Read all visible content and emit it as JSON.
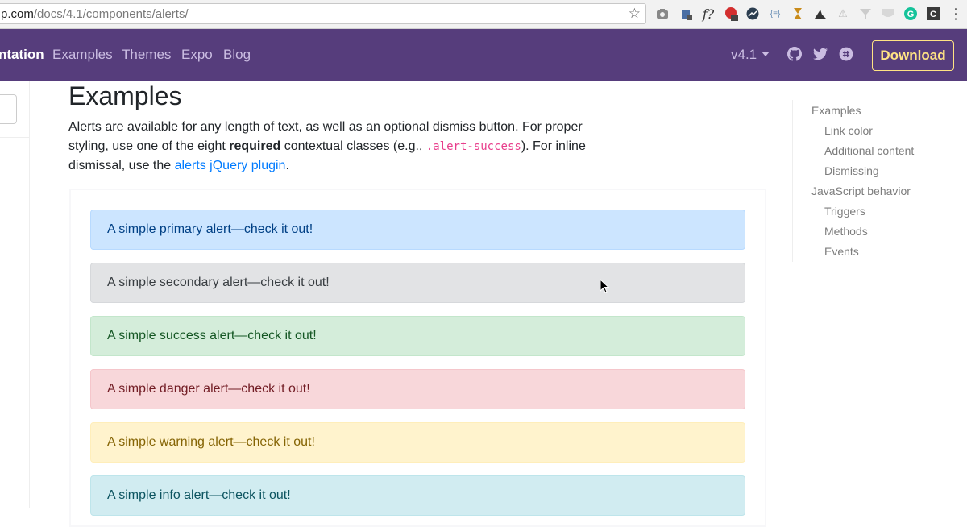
{
  "browser": {
    "url_prefix": "p.com",
    "url_path": "/docs/4.1/components/alerts/"
  },
  "navbar": {
    "items": [
      {
        "label": "ntation"
      },
      {
        "label": "Examples"
      },
      {
        "label": "Themes"
      },
      {
        "label": "Expo"
      },
      {
        "label": "Blog"
      }
    ],
    "version": "v4.1",
    "download": "Download",
    "icons": [
      "github-icon",
      "twitter-icon",
      "slack-icon"
    ]
  },
  "main": {
    "heading": "Examples",
    "lead": {
      "part1": "Alerts are available for any length of text, as well as an optional dismiss button. For proper styling, use one of the eight ",
      "bold": "required",
      "part2": " contextual classes (e.g., ",
      "code": ".alert-success",
      "part3": "). For inline dismissal, use the ",
      "link": "alerts jQuery plugin",
      "part4": "."
    },
    "alerts": [
      {
        "text": "A simple primary alert—check it out!"
      },
      {
        "text": "A simple secondary alert—check it out!"
      },
      {
        "text": "A simple success alert—check it out!"
      },
      {
        "text": "A simple danger alert—check it out!"
      },
      {
        "text": "A simple warning alert—check it out!"
      },
      {
        "text": "A simple info alert—check it out!"
      }
    ]
  },
  "toc": {
    "items": [
      {
        "label": "Examples"
      },
      {
        "label": "Link color"
      },
      {
        "label": "Additional content"
      },
      {
        "label": "Dismissing"
      },
      {
        "label": "JavaScript behavior"
      },
      {
        "label": "Triggers"
      },
      {
        "label": "Methods"
      },
      {
        "label": "Events"
      }
    ]
  },
  "colors": {
    "navbar": "#563d7c",
    "download": "#ffe484",
    "link": "#007bff"
  }
}
